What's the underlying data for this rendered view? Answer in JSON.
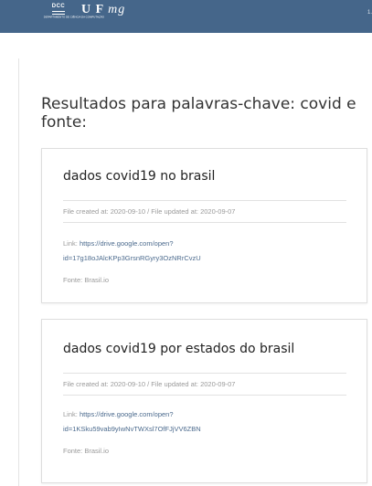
{
  "header": {
    "dcc_logo_mark": "DCC",
    "dcc_logo_subtitle": "DEPARTAMENTO DE CIÊNCIA DA COMPUTAÇÃO",
    "ufmg_logo": "UFMG",
    "right_text": "1."
  },
  "colors": {
    "header_bg": "#45668a",
    "link": "#4b6a8d",
    "muted_text": "#9a9a9a"
  },
  "search": {
    "title": "Resultados para palavras-chave: covid e fonte:"
  },
  "results": [
    {
      "title": "dados covid19 no brasil",
      "dates": "File created at: 2020-09-10 / File updated at: 2020-09-07",
      "link_label": "Link:",
      "link_text_1": "https://drive.google.com/open?",
      "link_text_2": "id=17g18oJAlcKPp3GrsnRGyry3OzNRrCvzU",
      "source": "Fonte: Brasil.io"
    },
    {
      "title": "dados covid19 por estados do brasil",
      "dates": "File created at: 2020-09-10 / File updated at: 2020-09-07",
      "link_label": "Link:",
      "link_text_1": "https://drive.google.com/open?",
      "link_text_2": "id=1KSku59vab9yIwNvTWXsl7OfFJjVV6ZBN",
      "source": "Fonte: Brasil.io"
    }
  ]
}
